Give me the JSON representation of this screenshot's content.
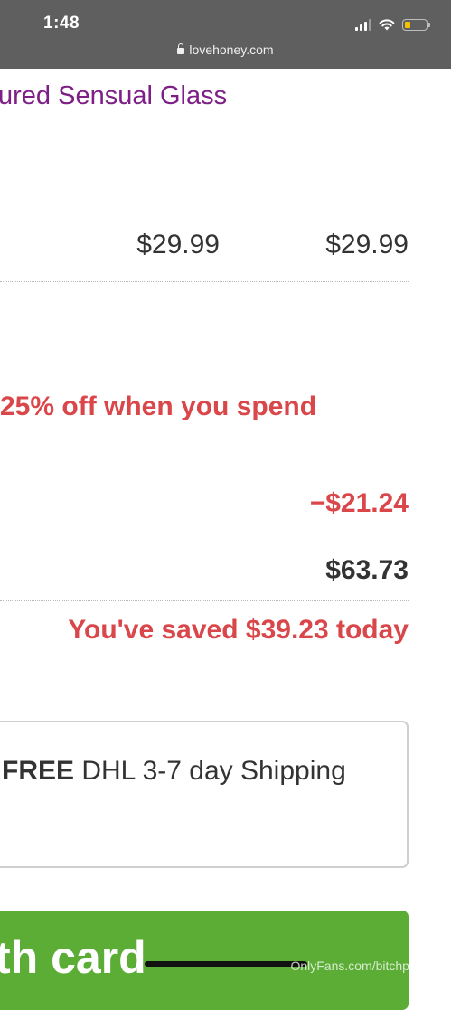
{
  "status_bar": {
    "time": "1:48",
    "url": "lovehoney.com",
    "icons": [
      "cellular-signal-icon",
      "wifi-icon",
      "battery-low-icon",
      "lock-icon"
    ],
    "battery_color": "#f5c200"
  },
  "cart_item": {
    "title": "ured Sensual Glass",
    "unit_price": "$29.99",
    "line_total": "$29.99"
  },
  "promotion": {
    "text": "25% off when you spend"
  },
  "summary": {
    "discount": "−$21.24",
    "total": "$63.73",
    "savings": "You've saved $39.23 today"
  },
  "shipping": {
    "free_label": "FREE",
    "description": " DHL 3-7 day Shipping"
  },
  "checkout": {
    "pay_button_label": "th card"
  },
  "watermark": "OnlyFans.com/bitchpudding",
  "colors": {
    "status_bar_bg": "#5f5f5f",
    "title_purple": "#7d1f86",
    "promo_red": "#d9474b",
    "text_dark": "#333333",
    "pay_green": "#5bad36"
  }
}
